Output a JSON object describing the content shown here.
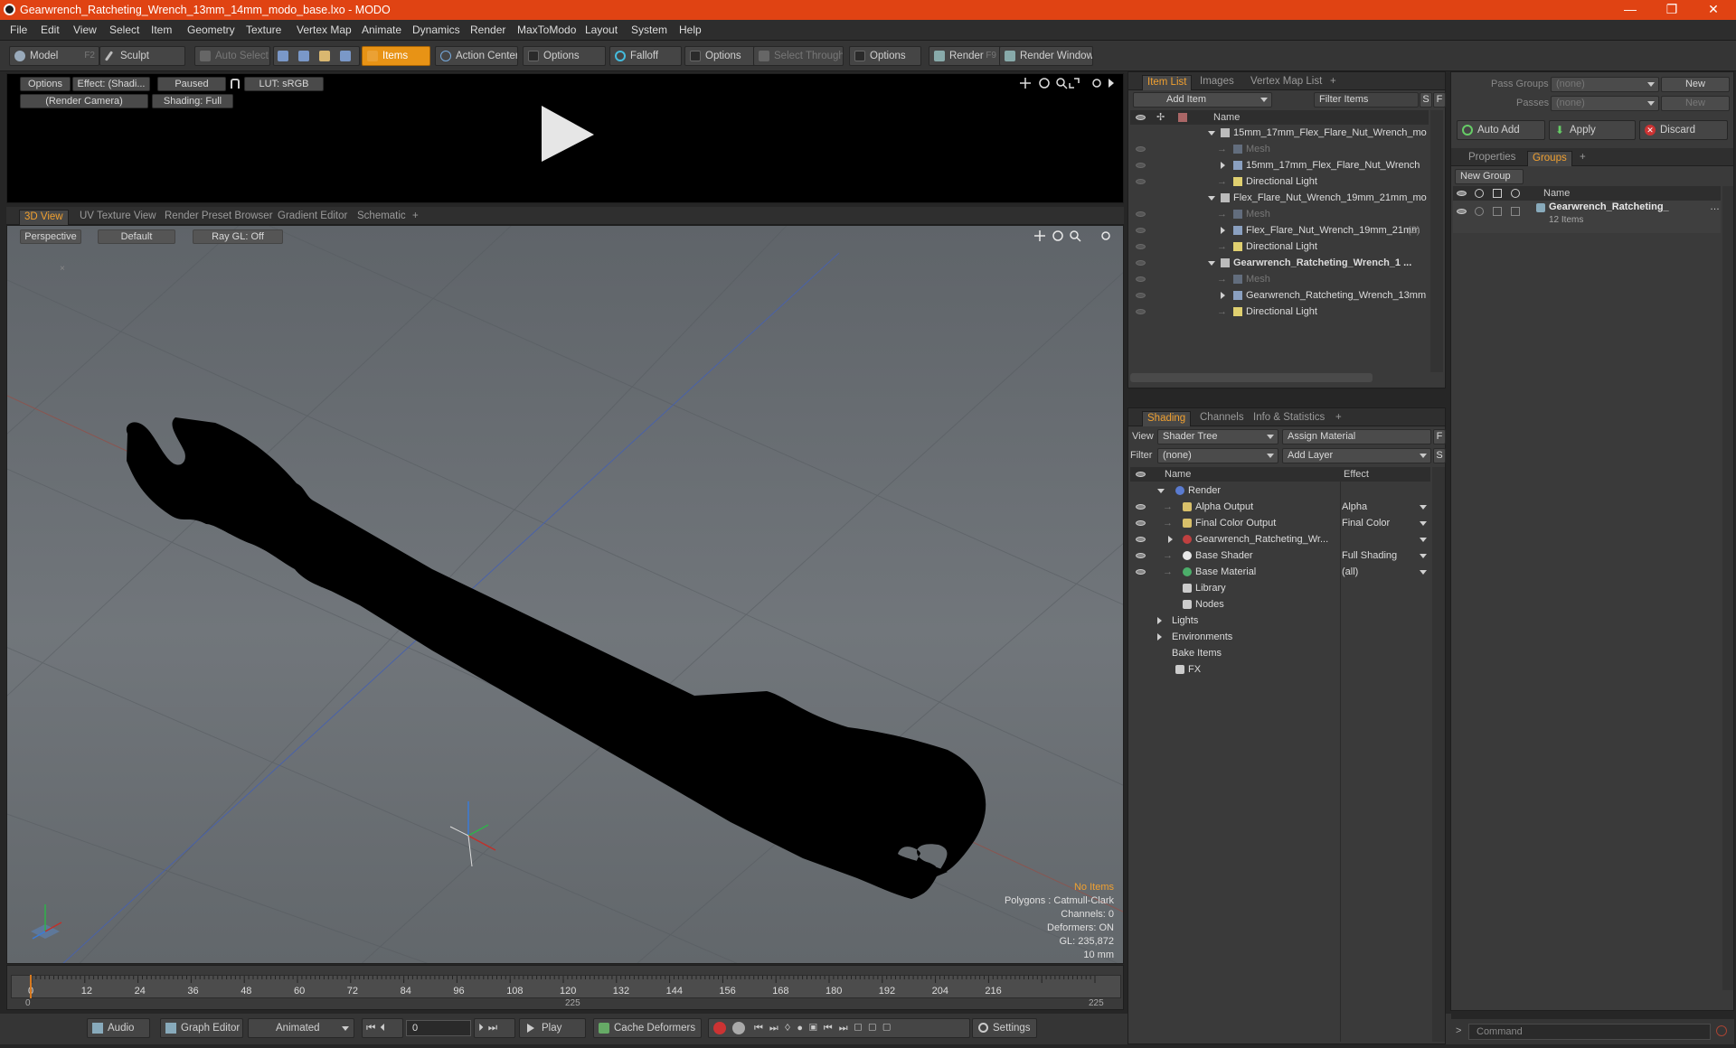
{
  "window": {
    "title": "Gearwrench_Ratcheting_Wrench_13mm_14mm_modo_base.lxo - MODO",
    "controls": [
      "minimize-icon",
      "restore-icon",
      "close-icon"
    ]
  },
  "menu": [
    "File",
    "Edit",
    "View",
    "Select",
    "Item",
    "Geometry",
    "Texture",
    "Vertex Map",
    "Animate",
    "Dynamics",
    "Render",
    "MaxToModo",
    "Layout",
    "System",
    "Help"
  ],
  "toolbar": {
    "model": "Model",
    "model_key": "F2",
    "sculpt": "Sculpt",
    "auto_select": "Auto Select",
    "items": "Items",
    "action_center": "Action Center",
    "options1": "Options",
    "falloff": "Falloff",
    "options2": "Options",
    "select_through": "Select Through",
    "options3": "Options",
    "render": "Render",
    "render_key": "F9",
    "render_window": "Render Window"
  },
  "preview": {
    "options": "Options",
    "effect": "Effect: (Shadi...",
    "paused": "Paused",
    "lut": "LUT: sRGB",
    "camera": "(Render Camera)",
    "shading": "Shading: Full"
  },
  "viewport": {
    "tabs": [
      "3D View",
      "UV Texture View",
      "Render Preset Browser",
      "Gradient Editor",
      "Schematic"
    ],
    "active_tab": "3D View",
    "perspective": "Perspective",
    "default": "Default",
    "raygl": "Ray GL: Off",
    "hud": {
      "no_items": "No Items",
      "polygons": "Polygons : Catmull-Clark",
      "channels": "Channels: 0",
      "deformers": "Deformers: ON",
      "gl": "GL: 235,872",
      "scale": "10 mm"
    }
  },
  "timeline": {
    "ticks": [
      "0",
      "12",
      "24",
      "36",
      "48",
      "60",
      "72",
      "84",
      "96",
      "108",
      "120",
      "132",
      "144",
      "156",
      "168",
      "180",
      "192",
      "204",
      "216"
    ],
    "range_start": "0",
    "range_mid": "225",
    "range_end": "225"
  },
  "bottom": {
    "audio": "Audio",
    "graph_editor": "Graph Editor",
    "animated": "Animated",
    "frame": "0",
    "play": "Play",
    "cache_deformers": "Cache Deformers",
    "settings": "Settings",
    "command_placeholder": "Command"
  },
  "item_list": {
    "tabs": [
      "Item List",
      "Images",
      "Vertex Map List"
    ],
    "add_item": "Add Item",
    "filter_items": "Filter Items",
    "s": "S",
    "f": "F",
    "col_name": "Name",
    "rows": [
      {
        "label": "15mm_17mm_Flex_Flare_Nut_Wrench_mo ...",
        "kind": "scene",
        "indent": 0,
        "expand": "down",
        "bold": false,
        "eye": false
      },
      {
        "label": "Mesh",
        "kind": "mesh-dim",
        "indent": 1,
        "expand": "",
        "bold": false,
        "eye": true
      },
      {
        "label": "15mm_17mm_Flex_Flare_Nut_Wrench",
        "kind": "mesh",
        "indent": 1,
        "expand": "right",
        "bold": false,
        "eye": true
      },
      {
        "label": "Directional Light",
        "kind": "light",
        "indent": 1,
        "expand": "",
        "bold": false,
        "eye": true
      },
      {
        "label": "Flex_Flare_Nut_Wrench_19mm_21mm_mo ...",
        "kind": "scene",
        "indent": 0,
        "expand": "down",
        "bold": false,
        "eye": false
      },
      {
        "label": "Mesh",
        "kind": "mesh-dim",
        "indent": 1,
        "expand": "",
        "bold": false,
        "eye": true
      },
      {
        "label": "Flex_Flare_Nut_Wrench_19mm_21mm",
        "kind": "mesh",
        "indent": 1,
        "expand": "right",
        "bold": false,
        "eye": true,
        "suffix": "(2)"
      },
      {
        "label": "Directional Light",
        "kind": "light",
        "indent": 1,
        "expand": "",
        "bold": false,
        "eye": true
      },
      {
        "label": "Gearwrench_Ratcheting_Wrench_1 ...",
        "kind": "scene",
        "indent": 0,
        "expand": "down",
        "bold": true,
        "eye": true
      },
      {
        "label": "Mesh",
        "kind": "mesh-dim",
        "indent": 1,
        "expand": "",
        "bold": false,
        "eye": true
      },
      {
        "label": "Gearwrench_Ratcheting_Wrench_13mm ...",
        "kind": "mesh",
        "indent": 1,
        "expand": "right",
        "bold": false,
        "eye": true
      },
      {
        "label": "Directional Light",
        "kind": "light",
        "indent": 1,
        "expand": "",
        "bold": false,
        "eye": true
      }
    ]
  },
  "shading": {
    "tabs": [
      "Shading",
      "Channels",
      "Info & Statistics"
    ],
    "view_label": "View",
    "view_value": "Shader Tree",
    "assign_material": "Assign Material",
    "f": "F",
    "filter_label": "Filter",
    "filter_value": "(none)",
    "add_layer": "Add Layer",
    "s": "S",
    "col_name": "Name",
    "col_effect": "Effect",
    "rows": [
      {
        "label": "Render",
        "effect": "",
        "indent": 0,
        "expand": "down",
        "icon": "render",
        "eye": false
      },
      {
        "label": "Alpha Output",
        "effect": "Alpha",
        "indent": 1,
        "expand": "",
        "icon": "output",
        "eye": true
      },
      {
        "label": "Final Color Output",
        "effect": "Final Color",
        "indent": 1,
        "expand": "",
        "icon": "output",
        "eye": true
      },
      {
        "label": "Gearwrench_Ratcheting_Wr...",
        "effect": "",
        "indent": 1,
        "expand": "right",
        "icon": "material-group",
        "eye": true
      },
      {
        "label": "Base Shader",
        "effect": "Full Shading",
        "indent": 1,
        "expand": "",
        "icon": "shader",
        "eye": true
      },
      {
        "label": "Base Material",
        "effect": "(all)",
        "indent": 1,
        "expand": "",
        "icon": "material",
        "eye": true
      },
      {
        "label": "Library",
        "effect": "",
        "indent": 1,
        "expand": "",
        "icon": "folder",
        "eye": false
      },
      {
        "label": "Nodes",
        "effect": "",
        "indent": 1,
        "expand": "",
        "icon": "folder",
        "eye": false
      },
      {
        "label": "Lights",
        "effect": "",
        "indent": 0,
        "expand": "right",
        "icon": "",
        "eye": false
      },
      {
        "label": "Environments",
        "effect": "",
        "indent": 0,
        "expand": "right",
        "icon": "",
        "eye": false
      },
      {
        "label": "Bake Items",
        "effect": "",
        "indent": 0,
        "expand": "",
        "icon": "",
        "eye": false
      },
      {
        "label": "FX",
        "effect": "",
        "indent": 0,
        "expand": "",
        "icon": "fx",
        "eye": false
      }
    ]
  },
  "groups_panel": {
    "pass_groups_label": "Pass Groups",
    "pass_groups_value": "(none)",
    "new1": "New",
    "passes_label": "Passes",
    "passes_value": "(none)",
    "new2": "New",
    "auto_add": "Auto Add",
    "apply": "Apply",
    "discard": "Discard",
    "tabs": [
      "Properties",
      "Groups"
    ],
    "new_group": "New Group",
    "col_name": "Name",
    "group_name": "Gearwrench_Ratcheting_",
    "group_count": "12 Items"
  },
  "colors": {
    "accent": "#e89315",
    "titlebar": "#e04313",
    "tab_active": "#f0a030"
  }
}
